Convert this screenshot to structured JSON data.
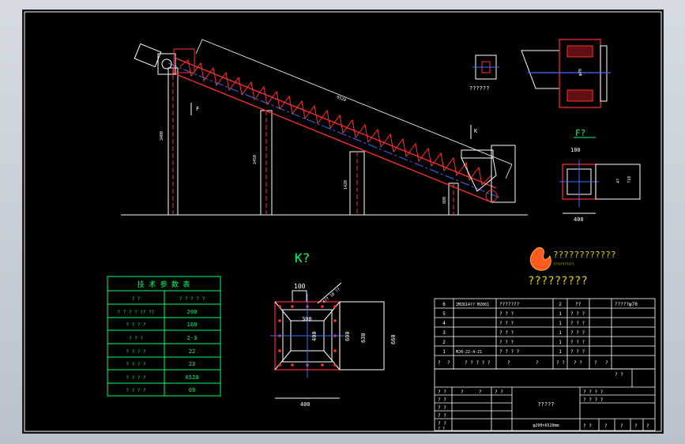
{
  "drawing": {
    "main_dims": {
      "slope_length": "6520",
      "h1": "3400",
      "h2": "2450",
      "h3": "1420",
      "h4": "880"
    },
    "view_label_f": "F",
    "view_label_k": "K",
    "section_label": "??????",
    "f_view": {
      "title": "F?",
      "dim_top": "100",
      "dim_bottom": "400",
      "dim_side_a": "4?",
      "dim_side_b": "?18"
    },
    "k_view": {
      "title": "K?",
      "dim_top": "100",
      "dim_inner": "300",
      "dim_mid": "400",
      "dim_h1": "600",
      "dim_h2": "630",
      "dim_h3": "660",
      "dim_bottom": "400",
      "bolt_note": "4?? 18 ??"
    },
    "logo_text": "????????????",
    "logo_sub": "???????????",
    "company_text": "?????????"
  },
  "tech_table": {
    "title": "技 术 参 数 表",
    "rows": [
      {
        "label": "? ?",
        "value": "? ? ? ? ?"
      },
      {
        "label": "? ? ? ? (? ?)",
        "value": "200"
      },
      {
        "label": "? ? ? ?",
        "value": "160"
      },
      {
        "label": "? ? ?",
        "value": "2-3"
      },
      {
        "label": "? ? ? ?",
        "value": "22"
      },
      {
        "label": "? ? ? ?",
        "value": "23"
      },
      {
        "label": "? ? ? ?",
        "value": "6520"
      },
      {
        "label": "? ? ? ?",
        "value": "09"
      }
    ]
  },
  "bom": {
    "rows": [
      {
        "no": "6",
        "code": "ZMZ614?? MZ061",
        "name": "???????",
        "qty": "2",
        "mat": "??",
        "note": "?????φ70"
      },
      {
        "no": "5",
        "code": "",
        "name": "? ? ?",
        "qty": "1",
        "mat": "? ? ?",
        "note": ""
      },
      {
        "no": "4",
        "code": "",
        "name": "? ? ?",
        "qty": "1",
        "mat": "? ? ?",
        "note": ""
      },
      {
        "no": "3",
        "code": "",
        "name": "? ? ?",
        "qty": "1",
        "mat": "? ? ?",
        "note": ""
      },
      {
        "no": "2",
        "code": "",
        "name": "? ? ?",
        "qty": "1",
        "mat": "? ? ?",
        "note": ""
      },
      {
        "no": "1",
        "code": "MJ0-22-4-21",
        "name": "? ? ? ?",
        "qty": "1",
        "mat": "? ? ?",
        "note": ""
      }
    ],
    "header": [
      "?",
      "?",
      "? ? ? ? ?",
      "?",
      "?",
      "? ?",
      "? ?",
      "?",
      "?"
    ],
    "header_extra": "? ?"
  },
  "title_block": {
    "left_rows": [
      "? ?",
      "? ?",
      "? ?",
      "? ?",
      "? ?",
      "? ?"
    ],
    "col2": "?",
    "col3": "?",
    "col4": "? ?",
    "drawing_name": "?????",
    "drawing_no": "φ200×6520mm",
    "right_top": [
      "? ? ? ?",
      "? ? ? ?"
    ],
    "right_bottom": [
      "? ?",
      "?",
      "?",
      "?",
      "?"
    ]
  }
}
